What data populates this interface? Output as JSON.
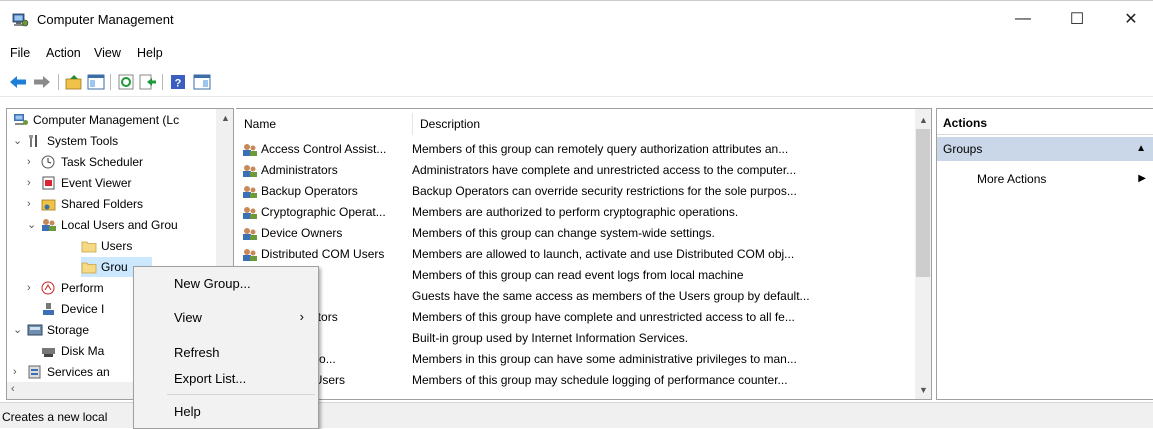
{
  "window": {
    "title": "Computer Management",
    "min": "—",
    "max": "☐",
    "close": "✕"
  },
  "menu": [
    "File",
    "Action",
    "View",
    "Help"
  ],
  "tree": {
    "root": "Computer Management (Lc",
    "system_tools": "System Tools",
    "task_scheduler": "Task Scheduler",
    "event_viewer": "Event Viewer",
    "shared_folders": "Shared Folders",
    "local_users": "Local Users and Grou",
    "users": "Users",
    "groups": "Grou",
    "performance": "Perform",
    "device_manager": "Device I",
    "storage": "Storage",
    "disk_management": "Disk Ma",
    "services": "Services an"
  },
  "list": {
    "col_name": "Name",
    "col_desc": "Description",
    "rows": [
      {
        "name": "Access Control Assist...",
        "desc": "Members of this group can remotely query authorization attributes an..."
      },
      {
        "name": "Administrators",
        "desc": "Administrators have complete and unrestricted access to the computer..."
      },
      {
        "name": "Backup Operators",
        "desc": "Backup Operators can override security restrictions for the sole purpos..."
      },
      {
        "name": "Cryptographic Operat...",
        "desc": "Members are authorized to perform cryptographic operations."
      },
      {
        "name": "Device Owners",
        "desc": "Members of this group can change system-wide settings."
      },
      {
        "name": "Distributed COM Users",
        "desc": "Members are allowed to launch, activate and use Distributed COM obj..."
      },
      {
        "name": "g Readers",
        "desc": "Members of this group can read event logs from local machine"
      },
      {
        "name": "",
        "desc": "Guests have the same access as members of the Users group by default..."
      },
      {
        "name": "Administrators",
        "desc": "Members of this group have complete and unrestricted access to all fe..."
      },
      {
        "name": "",
        "desc": "Built-in group used by Internet Information Services."
      },
      {
        "name": "Configuratio...",
        "desc": "Members in this group can have some administrative privileges to man..."
      },
      {
        "name": "ance Log Users",
        "desc": "Members of this group may schedule logging of performance counter..."
      }
    ]
  },
  "actions": {
    "header": "Actions",
    "group": "Groups",
    "more": "More Actions"
  },
  "context_menu": {
    "new_group": "New Group...",
    "view": "View",
    "refresh": "Refresh",
    "export": "Export List...",
    "help": "Help"
  },
  "status": "Creates a new local"
}
